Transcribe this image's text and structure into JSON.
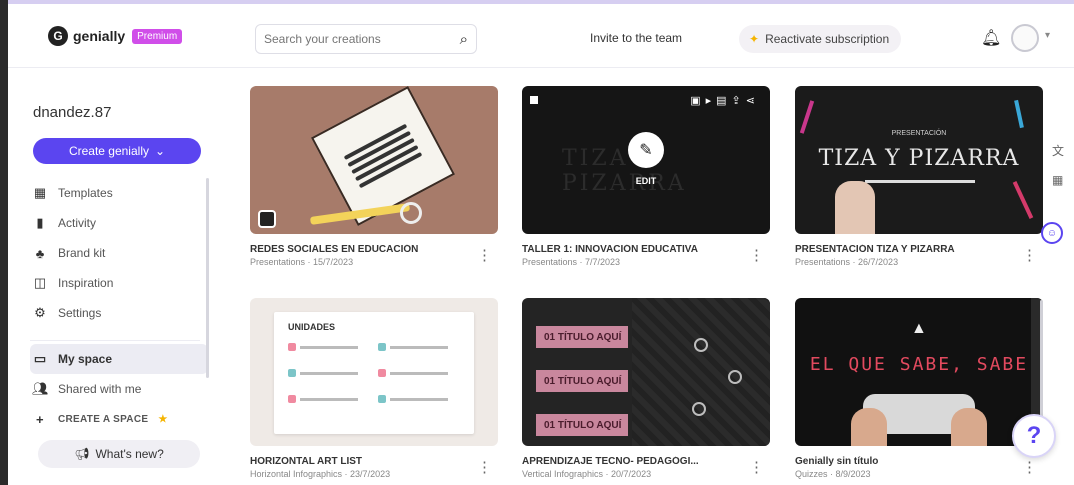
{
  "header": {
    "logo_text": "genially",
    "logo_badge": "Premium",
    "search_placeholder": "Search your creations",
    "invite_label": "Invite to the team",
    "reactivate_label": "Reactivate subscription"
  },
  "sidebar": {
    "username": "dnandez.87",
    "create_label": "Create genially",
    "items": [
      {
        "label": "Templates",
        "icon": "grid-icon"
      },
      {
        "label": "Activity",
        "icon": "chart-icon"
      },
      {
        "label": "Brand kit",
        "icon": "brand-icon"
      },
      {
        "label": "Inspiration",
        "icon": "inspiration-icon"
      },
      {
        "label": "Settings",
        "icon": "gear-icon"
      }
    ],
    "spaces": [
      {
        "label": "My space",
        "icon": "folder-icon"
      },
      {
        "label": "Shared with me",
        "icon": "users-icon"
      },
      {
        "label": "CREATE A SPACE",
        "icon": "plus-icon"
      }
    ],
    "whats_new_label": "What's new?"
  },
  "cards": [
    {
      "title": "REDES SOCIALES EN EDUCACIÓN",
      "subtitle": "Presentations · 15/7/2023"
    },
    {
      "title": "TALLER 1: INNOVACIÓN EDUCATIVA",
      "subtitle": "Presentations · 7/7/2023",
      "hover_label": "EDIT"
    },
    {
      "title": "PRESENTACIÓN TIZA Y PIZARRA",
      "subtitle": "Presentations · 26/7/2023",
      "thumb_title": "TIZA Y PIZARRA",
      "thumb_small": "PRESENTACIÓN"
    },
    {
      "title": "HORIZONTAL ART LIST",
      "subtitle": "Horizontal Infographics · 23/7/2023",
      "thumb_title": "UNIDADES"
    },
    {
      "title": "APRENDIZAJE TECNO- PEDAGÓGI...",
      "subtitle": "Vertical Infographics · 20/7/2023",
      "thumb_bands": [
        "01 TÍTULO AQUÍ",
        "01 TÍTULO AQUÍ",
        "01 TÍTULO AQUÍ"
      ]
    },
    {
      "title": "Genially sin título",
      "subtitle": "Quizzes · 8/9/2023",
      "thumb_title": "EL QUE SABE, SABE"
    }
  ],
  "colors": {
    "accent": "#5b45f0",
    "badge": "#d04ee9",
    "star": "#f5b400"
  }
}
